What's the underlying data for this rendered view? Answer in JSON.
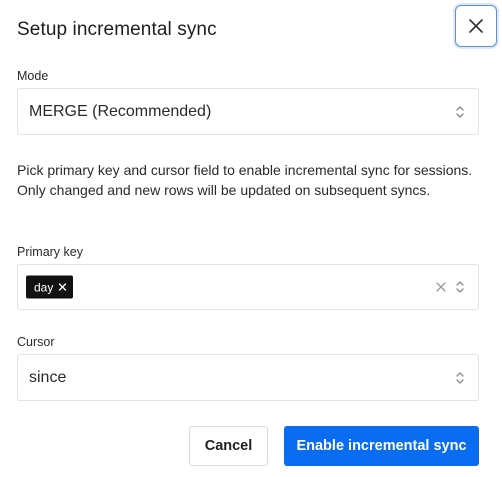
{
  "dialog": {
    "title": "Setup incremental sync"
  },
  "mode": {
    "label": "Mode",
    "value": "MERGE (Recommended)"
  },
  "description": "Pick primary key and cursor field to enable incremental sync for sessions. Only changed and new rows will be updated on subsequent syncs.",
  "primary_key": {
    "label": "Primary key",
    "chips": [
      "day"
    ]
  },
  "cursor": {
    "label": "Cursor",
    "value": "since"
  },
  "actions": {
    "cancel_label": "Cancel",
    "confirm_label": "Enable incremental sync"
  },
  "colors": {
    "primary": "#0a6cf0",
    "chip_bg": "#111111",
    "focus_ring": "#5c8ee0"
  },
  "icons": {
    "close": "close-icon",
    "select_arrows": "updown-icon",
    "clear": "clear-icon",
    "chip_remove": "chip-remove-icon"
  }
}
